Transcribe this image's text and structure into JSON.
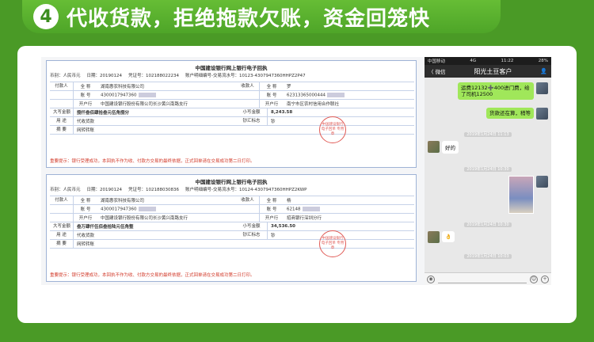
{
  "header": {
    "number": "4",
    "title": "代收货款，拒绝拖款欠账，资金回笼快"
  },
  "receipt1": {
    "title": "中国建设银行网上银行电子回执",
    "meta": [
      "币别：人民币元",
      "日期：20190124",
      "凭证号：102188022234",
      "账户明细编号-交易流水号：10123-4307947360HHPZ2P47"
    ],
    "payer_label": "付款人",
    "payee_label": "收款人",
    "rows": [
      [
        "全  称",
        "湖南惠农科技有限公司",
        "全  称",
        "罗"
      ],
      [
        "账  号",
        "4300017947360",
        "账  号",
        "62313365000444"
      ],
      [
        "开户行",
        "中国建设银行股份有限公司长沙黄兴南路支行",
        "开户行",
        "南宁市区农村信用合作联社"
      ]
    ],
    "amount_big_label": "大写金额",
    "amount_big": "捌仟叁佰肆拾叁元伍角捌分",
    "amount_small_label": "小写金额",
    "amount_small": "8,243.58",
    "usage_label": "用  途",
    "usage": "代收货款",
    "cash_label": "钞汇标志",
    "cash": "钞",
    "summary_label": "摘  要",
    "summary": "网转转账",
    "stamp": "中国建设银行 电子回单 专用章",
    "tip": "重要提示：银行受理成功，本回执不作为收、付款方交易的最终依据，正式回单请在交易成功第二日打印。"
  },
  "receipt2": {
    "title": "中国建设银行网上银行电子回执",
    "meta": [
      "币别：人民币元",
      "日期：20190124",
      "凭证号：102188030836",
      "账户明细编号-交易流水号：10124-4307947360HHPZ2KWP"
    ],
    "payer_label": "付款人",
    "payee_label": "收款人",
    "rows": [
      [
        "全  称",
        "湖南惠农科技有限公司",
        "全  称",
        "杨"
      ],
      [
        "账  号",
        "4300017947360",
        "账  号",
        "62148"
      ],
      [
        "开户行",
        "中国建设银行股份有限公司长沙黄兴南路支行",
        "开户行",
        "招商银行深圳分行"
      ]
    ],
    "amount_big_label": "大写金额",
    "amount_big": "叁万肆仟伍佰叁拾陆元伍角整",
    "amount_small_label": "小写金额",
    "amount_small": "34,536.50",
    "usage_label": "用  途",
    "usage": "代收货款",
    "cash_label": "钞汇标志",
    "cash": "钞",
    "summary_label": "摘  要",
    "summary": "网转转账",
    "stamp": "中国建设银行 电子回单 专用章",
    "tip": "重要提示：银行受理成功，本回执不作为收、付款方交易的最终依据，正式回单请在交易成功第二日打印。"
  },
  "phone": {
    "status_left": "中国移动",
    "status_center": "4G",
    "status_time": "11:22",
    "status_right": "28%",
    "back": "〈 微信",
    "title": "阳光土豆客户",
    "messages": {
      "m1": "运费12132➕400进门费，给了司机12500",
      "m2": "货款还在算，稍等",
      "ts1": "2019年1月24日 11:13",
      "m3": "好的",
      "ts2": "2019年1月24日 10:30",
      "ts3": "2019年1月24日 10:30",
      "ts4": "2019年1月24日 10:03"
    }
  }
}
